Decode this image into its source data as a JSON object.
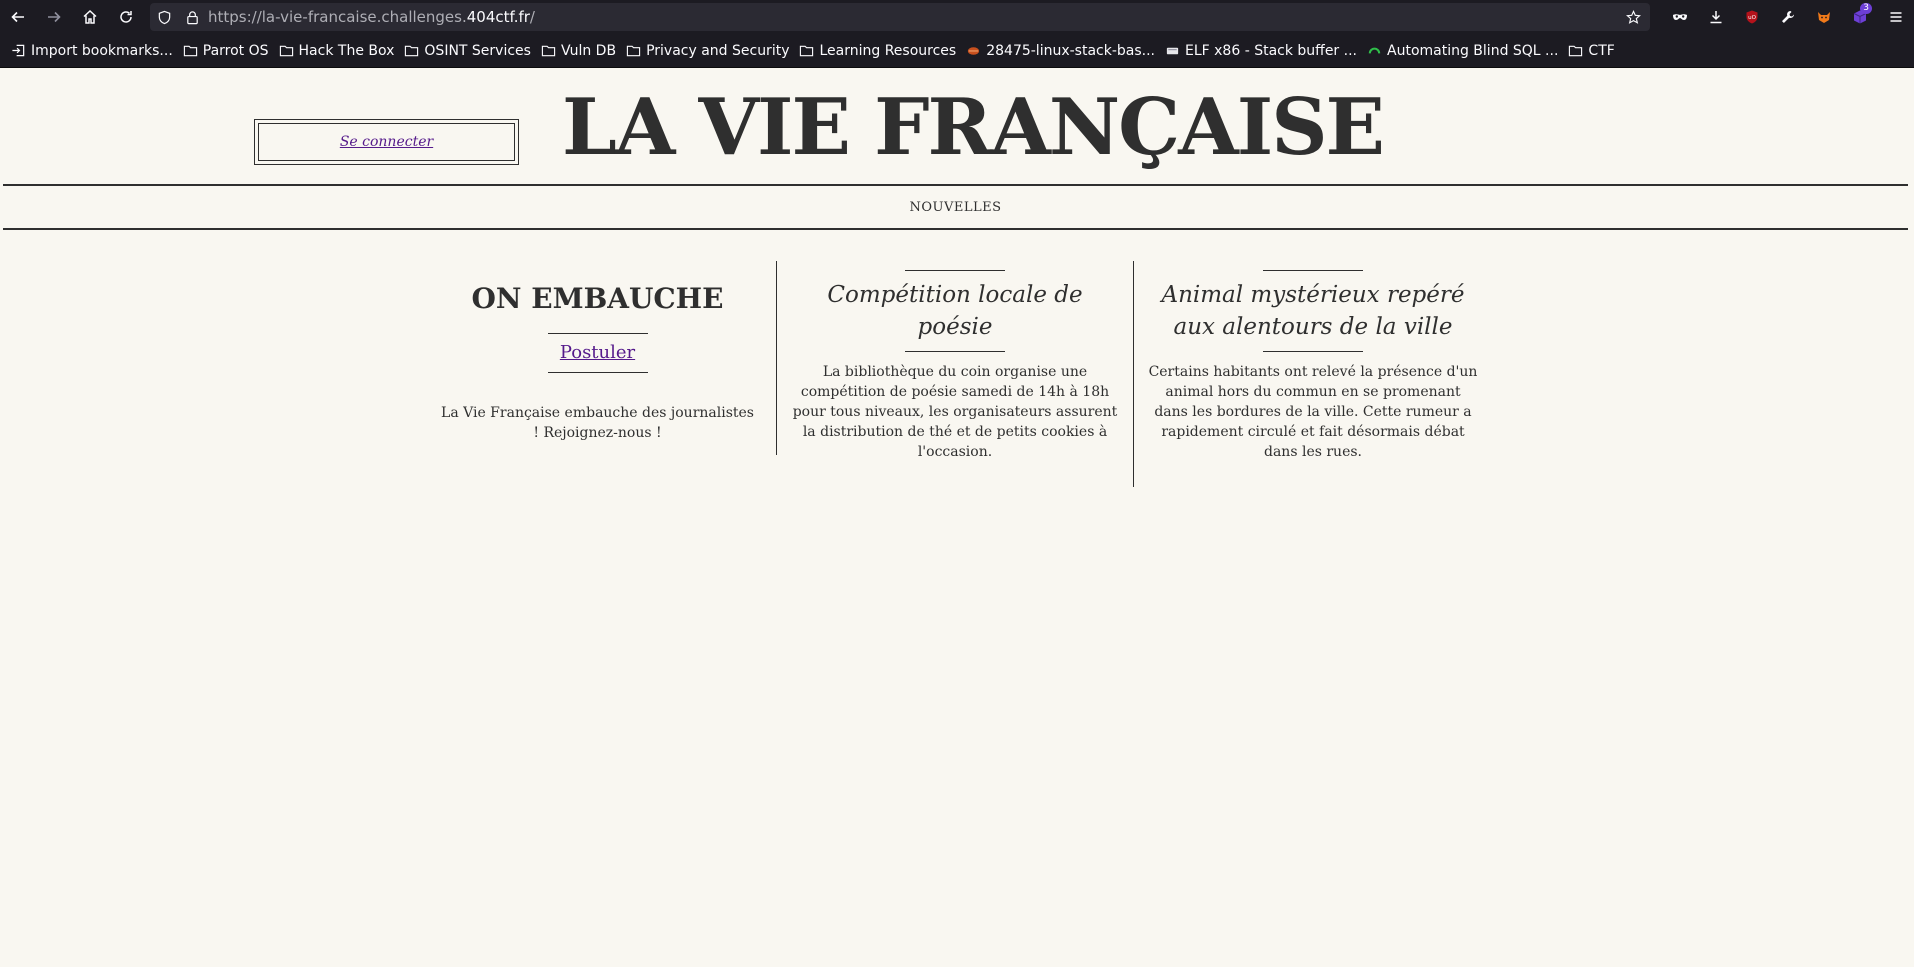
{
  "browser": {
    "url_prefix": "https://la-vie-francaise.challenges.",
    "url_host": "404ctf.fr",
    "url_suffix": "/",
    "extension_badge": "3"
  },
  "bookmarks": [
    {
      "label": "Import bookmarks...",
      "icon": "import-icon"
    },
    {
      "label": "Parrot OS",
      "icon": "folder-icon"
    },
    {
      "label": "Hack The Box",
      "icon": "folder-icon"
    },
    {
      "label": "OSINT Services",
      "icon": "folder-icon"
    },
    {
      "label": "Vuln DB",
      "icon": "folder-icon"
    },
    {
      "label": "Privacy and Security",
      "icon": "folder-icon"
    },
    {
      "label": "Learning Resources",
      "icon": "folder-icon"
    },
    {
      "label": "28475-linux-stack-bas...",
      "icon": "exploit-favicon"
    },
    {
      "label": "ELF x86 - Stack buffer ...",
      "icon": "rootme-favicon"
    },
    {
      "label": "Automating Blind SQL ...",
      "icon": "green-favicon"
    },
    {
      "label": "CTF",
      "icon": "folder-icon"
    }
  ],
  "site": {
    "login_label": "Se connecter",
    "masthead": "LA VIE FRANÇAISE",
    "nav_label": "NOUVELLES"
  },
  "articles": {
    "hiring": {
      "title": "ON EMBAUCHE",
      "link": "Postuler",
      "text": "La Vie Française embauche des journalistes ! Rejoignez-nous !"
    },
    "poetry": {
      "title": "Compétition locale de poésie",
      "text": "La bibliothèque du coin organise une compétition de poésie samedi de 14h à 18h pour tous niveaux, les organisateurs assurent la distribution de thé et de petits cookies à l'occasion."
    },
    "animal": {
      "title": "Animal mystérieux repéré aux alentours de la ville",
      "text": "Certains habitants ont relevé la présence d'un animal hors du commun en se promenant dans les bordures de la ville. Cette rumeur a rapidement circulé et fait désormais débat dans les rues."
    }
  },
  "colors": {
    "page_bg": "#f9f7f1",
    "ink": "#2f2f2f",
    "link": "#551a8b",
    "chrome_bg": "#1c1b22"
  }
}
